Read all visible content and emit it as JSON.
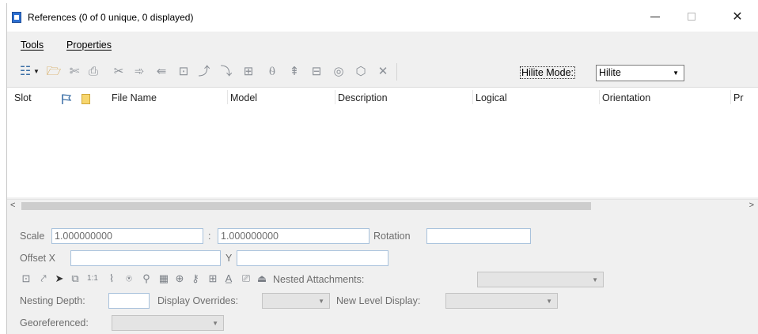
{
  "window": {
    "title": "References (0 of 0 unique, 0 displayed)",
    "controls": {
      "minimize": "—",
      "close": "✕"
    }
  },
  "menu": {
    "tools": "Tools",
    "properties": "Properties"
  },
  "toolbar": {
    "icons": [
      "list-options-icon",
      "dropdown-arrow-icon",
      "attach-reference-icon",
      "detach-icon",
      "reload-icon",
      "exchange-icon",
      "move-icon",
      "copy-icon",
      "scale-icon",
      "rotate-icon",
      "mirror-horizontal-icon",
      "mirror-vertical-icon",
      "clip-boundary-icon",
      "clip-mask-icon",
      "clip-front-icon",
      "clip-back-icon",
      "3d-icon",
      "delete-clip-icon"
    ],
    "hilite_mode_label": "Hilite Mode:",
    "hilite_mode_value": "Hilite"
  },
  "columns": {
    "slot": "Slot",
    "file_name": "File Name",
    "model": "Model",
    "description": "Description",
    "logical": "Logical",
    "orientation": "Orientation",
    "presentation": "Pr"
  },
  "rows": [],
  "properties": {
    "scale_label": "Scale",
    "scale_value_1": "1.000000000",
    "scale_separator": ":",
    "scale_value_2": "1.000000000",
    "rotation_label": "Rotation",
    "rotation_value": "",
    "offset_x_label": "Offset X",
    "offset_x_value": "",
    "offset_y_label": "Y",
    "offset_y_value": "",
    "nested_attachments_label": "Nested Attachments:",
    "nested_attachments_value": "",
    "nesting_depth_label": "Nesting Depth:",
    "nesting_depth_value": "",
    "display_overrides_label": "Display Overrides:",
    "display_overrides_value": "",
    "new_level_display_label": "New Level Display:",
    "new_level_display_value": "",
    "georeferenced_label": "Georeferenced:",
    "georeferenced_value": ""
  },
  "settings_icons": [
    "display-icon",
    "snap-icon",
    "locate-icon",
    "ignore-attachment-icon",
    "true-scale-icon",
    "scale-line-styles-icon",
    "treat-as-element-icon",
    "use-lights-icon",
    "raster-icon",
    "clip-volume-icon",
    "lock-icon",
    "level-icon",
    "annotation-icon",
    "print-icon",
    "lock-attachment-icon"
  ],
  "colors": {
    "window_bg": "#f0f0f0",
    "field_border": "#a9c2dc",
    "accent_icon": "#2d6fd0"
  }
}
